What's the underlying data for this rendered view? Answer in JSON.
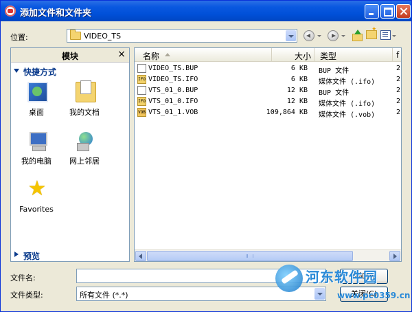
{
  "window": {
    "title": "添加文件和文件夹"
  },
  "location": {
    "label": "位置:",
    "value": "VIDEO_TS"
  },
  "left_panel": {
    "title": "模块",
    "close_glyph": "×",
    "shortcuts_header": "快捷方式",
    "items": [
      {
        "label": "桌面",
        "icon": "desktop-icon"
      },
      {
        "label": "我的文档",
        "icon": "my-documents-icon"
      },
      {
        "label": "我的电脑",
        "icon": "my-computer-icon"
      },
      {
        "label": "网上邻居",
        "icon": "network-places-icon"
      },
      {
        "label": "Favorites",
        "icon": "favorites-star-icon"
      }
    ],
    "preview_header": "预览"
  },
  "columns": {
    "name": "名称",
    "size": "大小",
    "type": "类型",
    "date": "f"
  },
  "files": [
    {
      "name": "VIDEO_TS.BUP",
      "size": "6 KB",
      "type": "BUP 文件",
      "date": "2",
      "icon": "bup-file-icon",
      "icon_text": ""
    },
    {
      "name": "VIDEO_TS.IFO",
      "size": "6 KB",
      "type": "媒体文件 (.ifo)",
      "date": "2",
      "icon": "ifo-file-icon",
      "icon_text": "IFO"
    },
    {
      "name": "VTS_01_0.BUP",
      "size": "12 KB",
      "type": "BUP 文件",
      "date": "2",
      "icon": "bup-file-icon",
      "icon_text": ""
    },
    {
      "name": "VTS_01_0.IFO",
      "size": "12 KB",
      "type": "媒体文件 (.ifo)",
      "date": "2",
      "icon": "ifo-file-icon",
      "icon_text": "IFO"
    },
    {
      "name": "VTS_01_1.VOB",
      "size": "109,864 KB",
      "type": "媒体文件 (.vob)",
      "date": "2",
      "icon": "vob-file-icon",
      "icon_text": "VOB"
    }
  ],
  "filename": {
    "label": "文件名:",
    "value": ""
  },
  "filetype": {
    "label": "文件类型:",
    "value": "所有文件 (*.*)"
  },
  "buttons": {
    "add": "添加(A)",
    "close": "关闭(C)"
  },
  "watermark": {
    "text": "河东软件园",
    "url": "www.pc0359.cn"
  }
}
